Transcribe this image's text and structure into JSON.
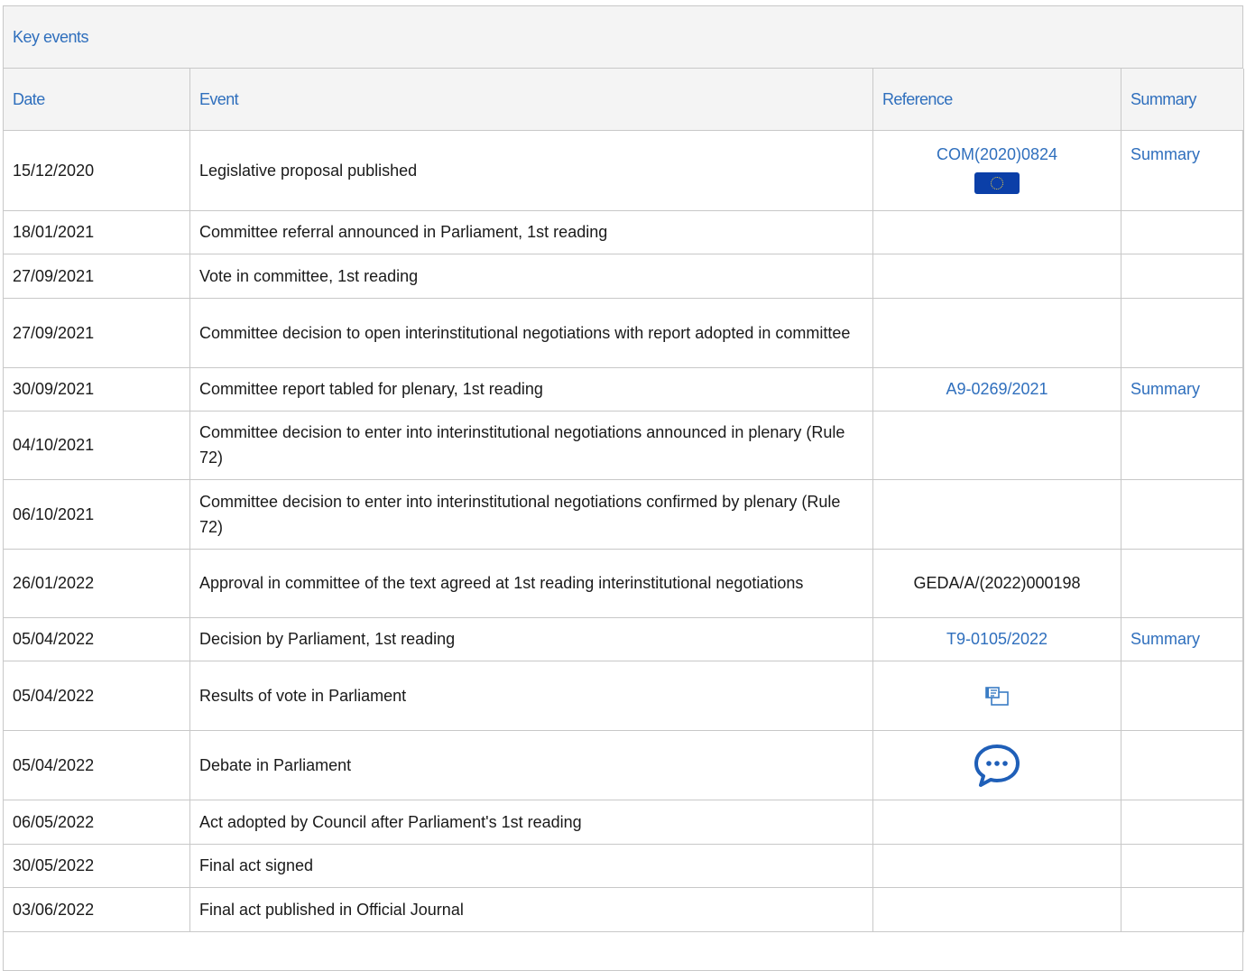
{
  "panel": {
    "title": "Key events"
  },
  "table": {
    "headers": {
      "date": "Date",
      "event": "Event",
      "reference": "Reference",
      "summary": "Summary"
    },
    "rows": [
      {
        "date": "15/12/2020",
        "event": "Legislative proposal published",
        "reference": "COM(2020)0824",
        "reference_is_link": true,
        "reference_icon": "eu-flag-icon",
        "summary": "Summary"
      },
      {
        "date": "18/01/2021",
        "event": "Committee referral announced in Parliament, 1st reading",
        "reference": "",
        "summary": ""
      },
      {
        "date": "27/09/2021",
        "event": "Vote in committee, 1st reading",
        "reference": "",
        "summary": ""
      },
      {
        "date": "27/09/2021",
        "event": "Committee decision to open interinstitutional negotiations with report adopted in committee",
        "reference": "",
        "summary": ""
      },
      {
        "date": "30/09/2021",
        "event": "Committee report tabled for plenary, 1st reading",
        "reference": "A9-0269/2021",
        "reference_is_link": true,
        "summary": "Summary"
      },
      {
        "date": "04/10/2021",
        "event": "Committee decision to enter into interinstitutional negotiations announced in plenary (Rule 72)",
        "reference": "",
        "summary": ""
      },
      {
        "date": "06/10/2021",
        "event": "Committee decision to enter into interinstitutional negotiations confirmed by plenary (Rule 72)",
        "reference": "",
        "summary": ""
      },
      {
        "date": "26/01/2022",
        "event": "Approval in committee of the text agreed at 1st reading interinstitutional negotiations",
        "reference": "GEDA/A/(2022)000198",
        "reference_is_link": false,
        "summary": ""
      },
      {
        "date": "05/04/2022",
        "event": "Decision by Parliament, 1st reading",
        "reference": "T9-0105/2022",
        "reference_is_link": true,
        "summary": "Summary"
      },
      {
        "date": "05/04/2022",
        "event": "Results of vote in Parliament",
        "reference": "",
        "reference_icon": "vote-results-icon",
        "summary": ""
      },
      {
        "date": "05/04/2022",
        "event": "Debate in Parliament",
        "reference": "",
        "reference_icon": "debate-chat-icon",
        "summary": ""
      },
      {
        "date": "06/05/2022",
        "event": "Act adopted by Council after Parliament's 1st reading",
        "reference": "",
        "summary": ""
      },
      {
        "date": "30/05/2022",
        "event": "Final act signed",
        "reference": "",
        "summary": ""
      },
      {
        "date": "03/06/2022",
        "event": "Final act published in Official Journal",
        "reference": "",
        "summary": ""
      }
    ]
  },
  "colors": {
    "link": "#2f6fbd",
    "header_bg": "#f4f4f4",
    "border": "#c8c8c8",
    "flag_blue": "#0b3fa8"
  }
}
